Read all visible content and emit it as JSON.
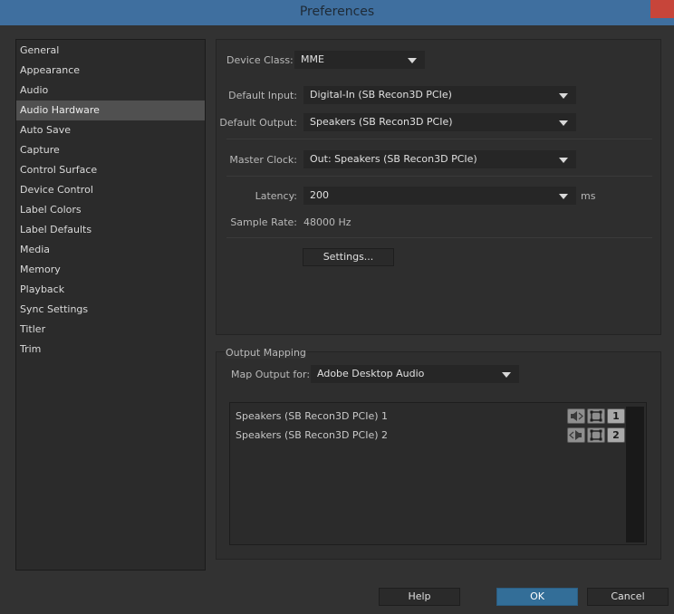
{
  "window": {
    "title": "Preferences"
  },
  "sidebar": {
    "items": [
      {
        "label": "General"
      },
      {
        "label": "Appearance"
      },
      {
        "label": "Audio"
      },
      {
        "label": "Audio Hardware"
      },
      {
        "label": "Auto Save"
      },
      {
        "label": "Capture"
      },
      {
        "label": "Control Surface"
      },
      {
        "label": "Device Control"
      },
      {
        "label": "Label Colors"
      },
      {
        "label": "Label Defaults"
      },
      {
        "label": "Media"
      },
      {
        "label": "Memory"
      },
      {
        "label": "Playback"
      },
      {
        "label": "Sync Settings"
      },
      {
        "label": "Titler"
      },
      {
        "label": "Trim"
      }
    ],
    "selected": "Audio Hardware"
  },
  "device": {
    "device_class_label": "Device Class:",
    "device_class_value": "MME",
    "default_input_label": "Default Input:",
    "default_input_value": "Digital-In (SB Recon3D PCIe)",
    "default_output_label": "Default Output:",
    "default_output_value": "Speakers (SB Recon3D PCIe)",
    "master_clock_label": "Master Clock:",
    "master_clock_value": "Out: Speakers (SB Recon3D PCIe)",
    "latency_label": "Latency:",
    "latency_value": "200",
    "latency_unit": "ms",
    "sample_rate_label": "Sample Rate:",
    "sample_rate_value": "48000 Hz",
    "settings_button": "Settings..."
  },
  "mapping": {
    "caption": "Output Mapping",
    "map_output_label": "Map Output for:",
    "map_output_value": "Adobe Desktop Audio",
    "rows": [
      {
        "label": "Speakers (SB Recon3D PCIe) 1",
        "channel": "1",
        "icon": "speaker-left-icon"
      },
      {
        "label": "Speakers (SB Recon3D PCIe) 2",
        "channel": "2",
        "icon": "speaker-right-icon"
      }
    ]
  },
  "footer": {
    "help": "Help",
    "ok": "OK",
    "cancel": "Cancel"
  },
  "colors": {
    "titlebar": "#3f6f9f",
    "selection": "#505050",
    "ok_button": "#336e98",
    "close_button": "#c7453a"
  }
}
